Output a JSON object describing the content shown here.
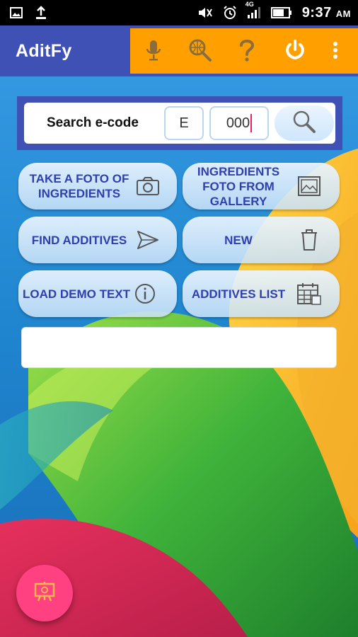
{
  "status_bar": {
    "time": "9:37",
    "ampm": "AM",
    "network": "4G",
    "icons": [
      "image-icon",
      "download-icon",
      "mute-icon",
      "alarm-icon",
      "signal-icon",
      "battery-icon"
    ]
  },
  "app_bar": {
    "title": "AditFy",
    "actions": [
      {
        "name": "microphone-icon"
      },
      {
        "name": "web-search-icon"
      },
      {
        "name": "help-icon"
      },
      {
        "name": "power-icon"
      },
      {
        "name": "more-vert-icon"
      }
    ]
  },
  "search": {
    "label": "Search e-code",
    "prefix_value": "E",
    "code_value": "000"
  },
  "buttons": {
    "take_foto": "TAKE A FOTO OF INGREDIENTS",
    "gallery": "INGREDIENTS FOTO FROM GALLERY",
    "find_additives": "FIND ADDITIVES",
    "new": "NEW",
    "load_demo": "LOAD DEMO TEXT",
    "additives_list": "ADDITIVES LIST"
  },
  "text_area": {
    "value": ""
  },
  "colors": {
    "primary": "#3f51b5",
    "accent_orange": "#ffa000",
    "button_text": "#2f3fb0",
    "fab": "#ff4081"
  }
}
